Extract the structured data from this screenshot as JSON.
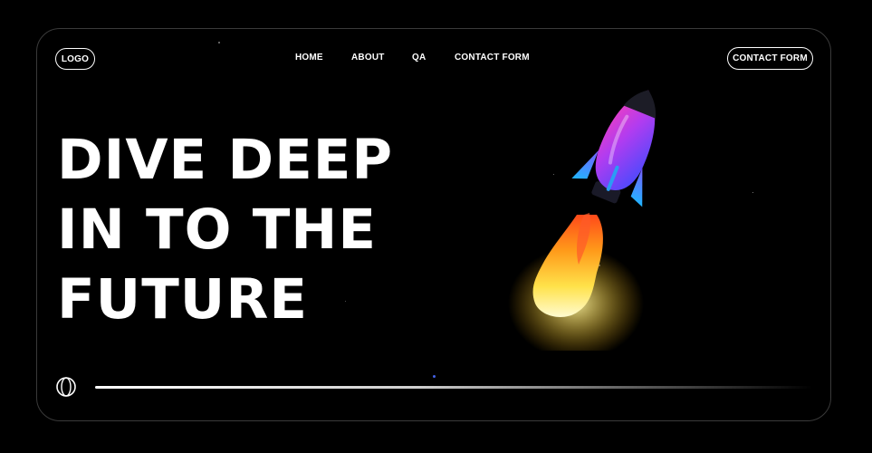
{
  "header": {
    "logo_label": "LOGO",
    "nav": [
      "HOME",
      "ABOUT",
      "QA",
      "CONTACT FORM"
    ],
    "cta_label": "CONTACT FORM"
  },
  "hero": {
    "lines": [
      "DIVE DEEP",
      "IN TO THE",
      "FUTURE"
    ]
  },
  "colors": {
    "background": "#000000",
    "text": "#ffffff",
    "rocket_body_top": "#e23bd6",
    "rocket_body_mid": "#8a2cf0",
    "rocket_fins": "#2a9df4",
    "flame_core": "#fff7b0",
    "flame_outer": "#ff7a1a"
  },
  "icons": {
    "loader": "ring-spinner-icon",
    "illustration": "rocket-icon"
  }
}
